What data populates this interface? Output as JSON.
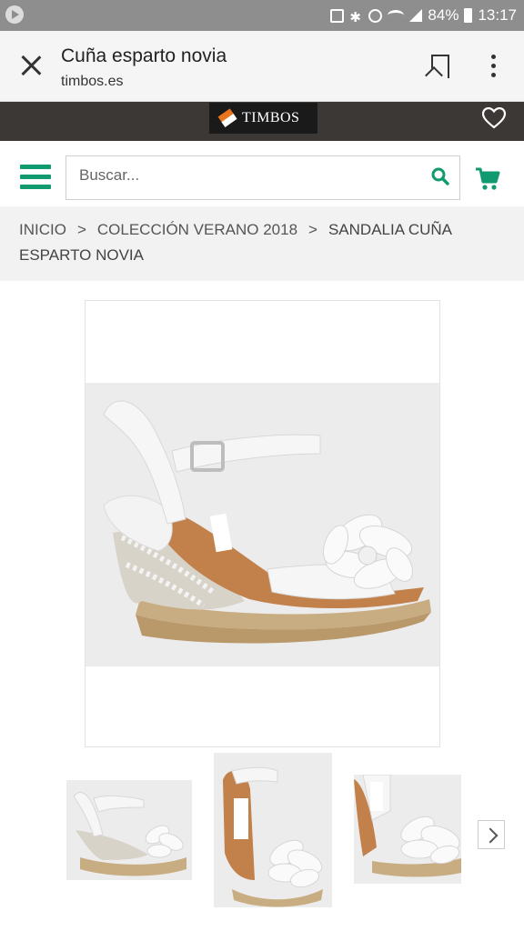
{
  "status_bar": {
    "battery": "84%",
    "time": "13:17"
  },
  "browser": {
    "title": "Cuña esparto novia",
    "domain": "timbos.es"
  },
  "brand": {
    "logo_text": "TIMBOS",
    "accent_color": "#e8741d"
  },
  "search": {
    "placeholder": "Buscar...",
    "icon_color": "#109a6f"
  },
  "breadcrumb": {
    "items": [
      "INICIO",
      "COLECCIÓN VERANO 2018",
      "SANDALIA CUÑA ESPARTO NOVIA"
    ],
    "separator": ">"
  },
  "product": {
    "image_alt": "Sandalia cuña esparto novia blanca"
  },
  "colors": {
    "brand_bar": "#3c3836",
    "primary_green": "#109a6f",
    "breadcrumb_bg": "#f2f2f2"
  }
}
